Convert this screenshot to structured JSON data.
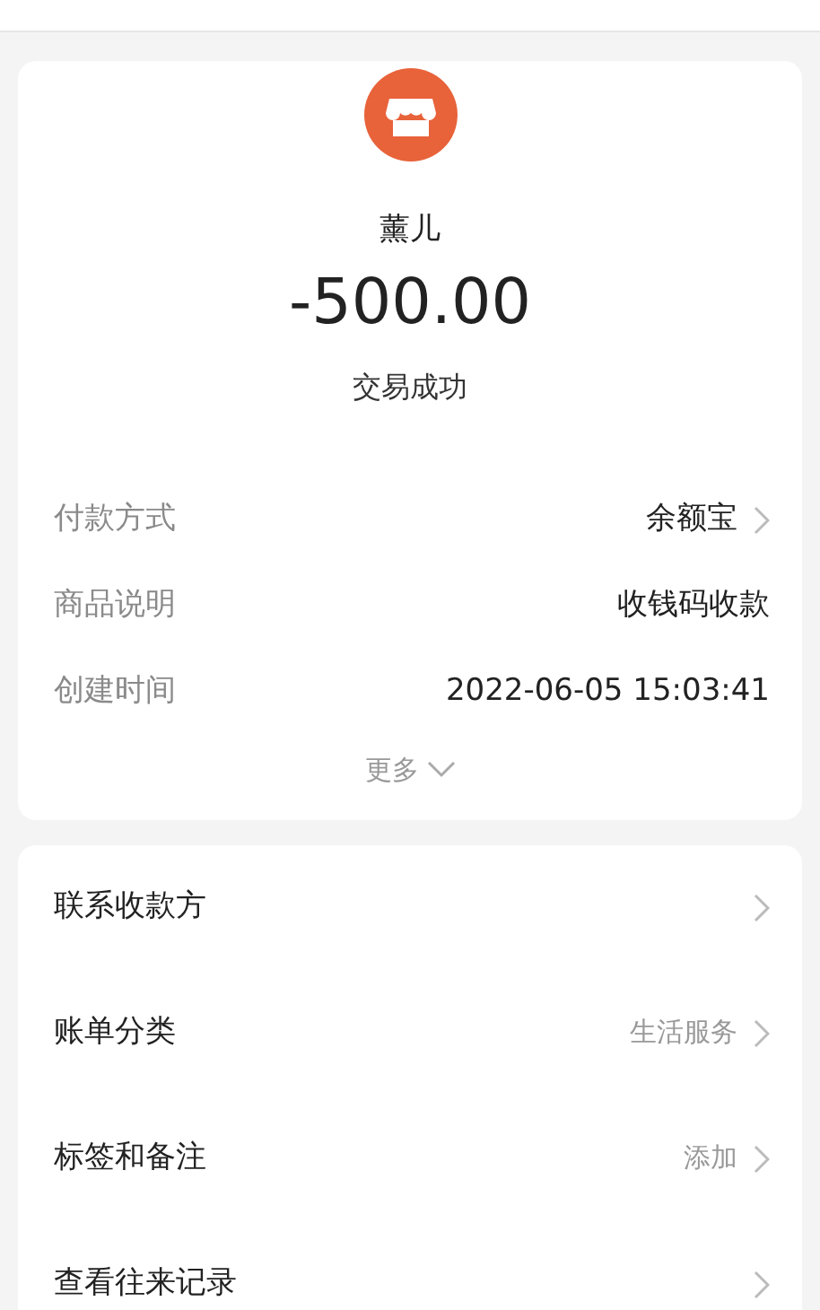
{
  "payee": {
    "name": "薰儿",
    "amount": "-500.00",
    "status": "交易成功"
  },
  "details": [
    {
      "label": "付款方式",
      "value": "余额宝",
      "chevron": true
    },
    {
      "label": "商品说明",
      "value": "收钱码收款",
      "chevron": false
    },
    {
      "label": "创建时间",
      "value": "2022-06-05 15:03:41",
      "chevron": false
    }
  ],
  "more": {
    "label": "更多"
  },
  "actions": [
    {
      "label": "联系收款方",
      "chevron": true
    },
    {
      "label": "账单分类",
      "value": "生活服务",
      "chevron": true
    },
    {
      "label": "标签和备注",
      "value": "添加",
      "chevron": true
    },
    {
      "label": "查看往来记录",
      "chevron": true
    }
  ]
}
